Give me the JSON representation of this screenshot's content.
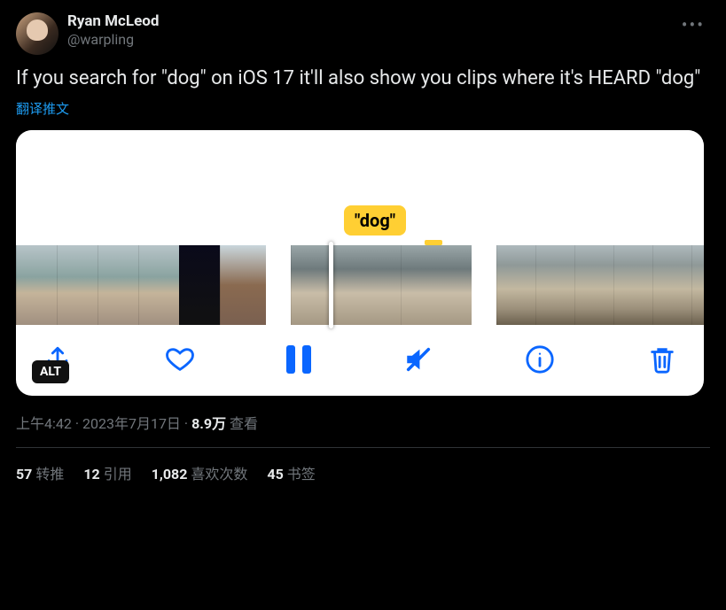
{
  "author": {
    "display_name": "Ryan McLeod",
    "handle": "@warpling"
  },
  "tweet_text": "If you search for \"dog\" on iOS 17 it'll also show you clips where it's HEARD \"dog\"",
  "translate_label": "翻译推文",
  "media": {
    "highlight_tag": "\"dog\"",
    "alt_badge": "ALT"
  },
  "timestamp": {
    "time": "上午4:42",
    "separator": " · ",
    "date": "2023年7月17日",
    "views_count": "8.9万",
    "views_label": " 查看"
  },
  "stats": {
    "retweets_count": "57",
    "retweets_label": "转推",
    "quotes_count": "12",
    "quotes_label": "引用",
    "likes_count": "1,082",
    "likes_label": "喜欢次数",
    "bookmarks_count": "45",
    "bookmarks_label": "书签"
  }
}
